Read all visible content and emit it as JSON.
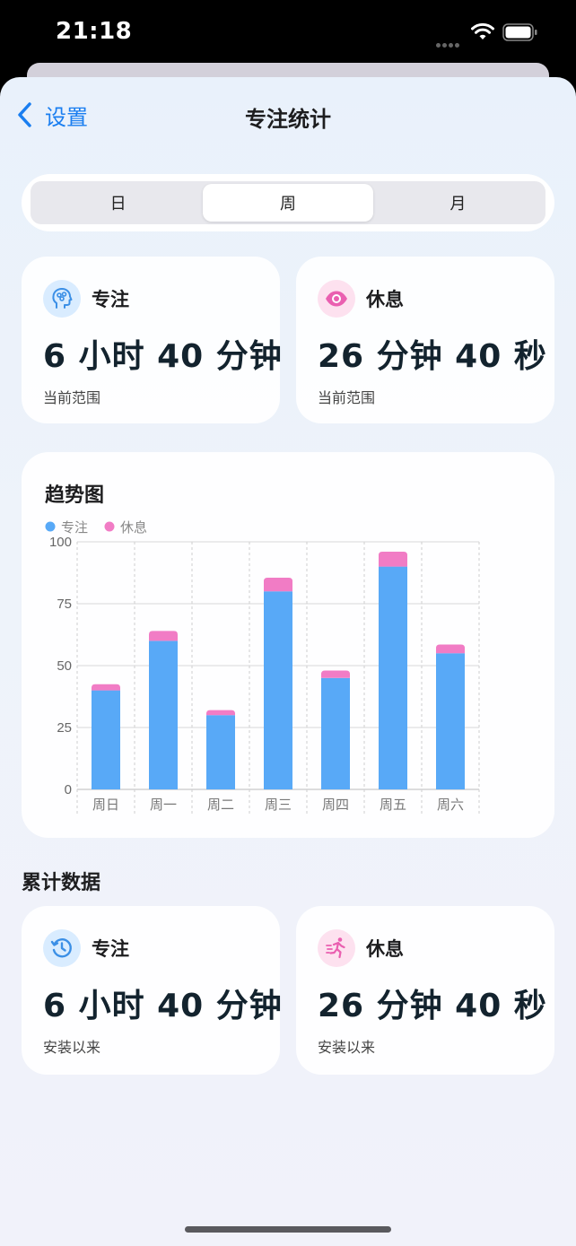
{
  "status_bar": {
    "time": "21:18"
  },
  "nav": {
    "back_label": "设置",
    "title": "专注统计"
  },
  "segments": [
    "日",
    "周",
    "月"
  ],
  "selected_segment": "周",
  "current_range": {
    "focus": {
      "label": "专注",
      "value": "6 小时 40 分钟",
      "sub": "当前范围",
      "icon": "brain-head-icon"
    },
    "rest": {
      "label": "休息",
      "value": "26 分钟 40 秒",
      "sub": "当前范围",
      "icon": "eye-icon"
    }
  },
  "trend": {
    "title": "趋势图"
  },
  "cumulative": {
    "title": "累计数据",
    "focus": {
      "label": "专注",
      "value": "6 小时 40 分钟",
      "sub": "安装以来",
      "icon": "history-clock-icon"
    },
    "rest": {
      "label": "休息",
      "value": "26 分钟 40 秒",
      "sub": "安装以来",
      "icon": "running-person-icon"
    }
  },
  "colors": {
    "focus": "#58a9f7",
    "rest": "#f17cc5",
    "accent": "#1a7ef0"
  },
  "chart_data": {
    "type": "bar",
    "stacked": true,
    "categories": [
      "周日",
      "周一",
      "周二",
      "周三",
      "周四",
      "周五",
      "周六"
    ],
    "series": [
      {
        "name": "专注",
        "values": [
          40,
          60,
          30,
          80,
          45,
          90,
          55
        ],
        "color": "#58a9f7"
      },
      {
        "name": "休息",
        "values": [
          2.5,
          4,
          2,
          5.5,
          3,
          6,
          3.5
        ],
        "color": "#f17cc5"
      }
    ],
    "yticks": [
      "0",
      "25",
      "50",
      "75",
      "100"
    ],
    "ylim": [
      0,
      100
    ],
    "legend": "top-left",
    "grid": true
  }
}
